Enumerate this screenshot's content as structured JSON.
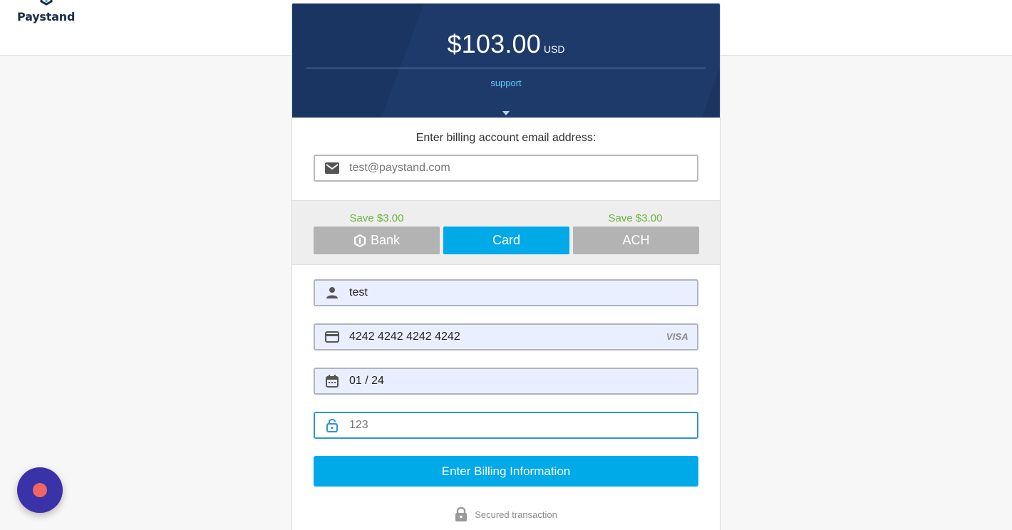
{
  "brand": {
    "name": "Paystand",
    "accent": "#00a9e8",
    "header_bg": "#1e3a6b",
    "save_color": "#6cb33f"
  },
  "header": {
    "amount": "$103.00",
    "currency": "USD",
    "support_label": "support"
  },
  "email": {
    "label": "Enter billing account email address:",
    "placeholder": "test@paystand.com",
    "icon": "mail-icon"
  },
  "methods": {
    "save_notes": [
      "Save $3.00",
      "Save $3.00"
    ],
    "tabs": [
      {
        "label": "Bank",
        "icon": "bank-logo-icon",
        "active": false
      },
      {
        "label": "Card",
        "active": true
      },
      {
        "label": "ACH",
        "active": false
      }
    ]
  },
  "card": {
    "name_value": "test",
    "number_value": "4242 4242 4242 4242",
    "brand_label": "VISA",
    "expiry_value": "01 / 24",
    "cvc_placeholder": "123"
  },
  "submit_label": "Enter Billing Information",
  "secure_label": "Secured transaction"
}
